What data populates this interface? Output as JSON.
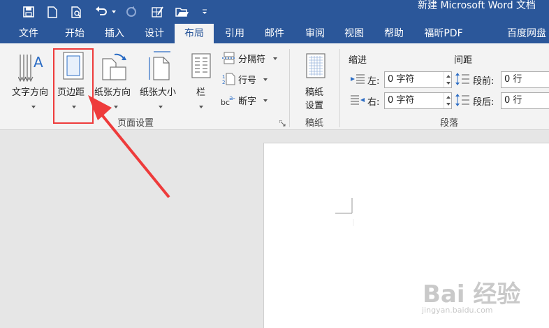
{
  "window": {
    "title": "新建 Microsoft Word 文档"
  },
  "tabs": [
    {
      "label": "文件"
    },
    {
      "label": "开始"
    },
    {
      "label": "插入"
    },
    {
      "label": "设计"
    },
    {
      "label": "布局",
      "active": true
    },
    {
      "label": "引用"
    },
    {
      "label": "邮件"
    },
    {
      "label": "审阅"
    },
    {
      "label": "视图"
    },
    {
      "label": "帮助"
    },
    {
      "label": "福昕PDF"
    },
    {
      "label": "百度网盘"
    }
  ],
  "page_setup": {
    "text_direction": "文字方向",
    "margins": "页边距",
    "orientation": "纸张方向",
    "size": "纸张大小",
    "columns": "栏",
    "breaks": "分隔符",
    "line_numbers": "行号",
    "hyphenation": "断字",
    "group_label": "页面设置"
  },
  "manuscript": {
    "button_line1": "稿纸",
    "button_line2": "设置",
    "group_label": "稿纸"
  },
  "paragraph": {
    "indent_header": "缩进",
    "spacing_header": "间距",
    "left_label": "左:",
    "right_label": "右:",
    "left_value": "0 字符",
    "right_value": "0 字符",
    "before_label": "段前:",
    "after_label": "段后:",
    "before_value": "0 行",
    "after_value": "0 行",
    "group_label": "段落"
  },
  "watermark": {
    "main": "Bai 经验",
    "sub": "jingyan.baidu.com"
  },
  "colors": {
    "accent": "#2b579a",
    "annotation": "#ee3b3b"
  }
}
